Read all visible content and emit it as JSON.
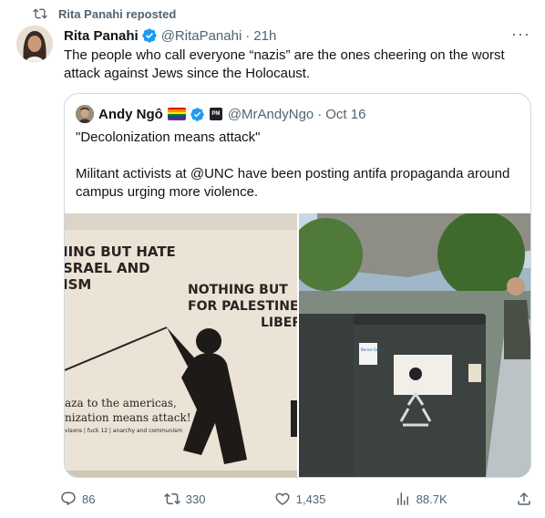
{
  "repost": {
    "label": "Rita Panahi reposted",
    "icon": "repost-icon"
  },
  "tweet": {
    "author_name": "Rita Panahi",
    "author_handle": "@RitaPanahi",
    "separator": "·",
    "time": "21h",
    "more_icon": "more-icon",
    "text": "The people who call everyone “nazis” are the ones cheering on the worst attack against Jews since the Holocaust."
  },
  "quote": {
    "author_name": "Andy Ngô",
    "author_handle": "@MrAndyNgo",
    "separator": "·",
    "date": "Oct 16",
    "badge_label": "PM",
    "text": "\"Decolonization means attack\"\n\nMilitant activists at @UNC have been posting antifa propaganda around campus urging more violence.",
    "poster_lines": [
      "IING BUT HATE",
      "SRAEL AND",
      "ISM",
      "NOTHING BUT",
      "FOR PALESTINE",
      "LIBERA",
      "aza to the americas,",
      "nization means attack!",
      "visons | fuck 12 | anarchy and communism"
    ],
    "sticker_label": "Bernie Seats"
  },
  "actions": {
    "replies": "86",
    "reposts": "330",
    "likes": "1,435",
    "views": "88.7K"
  },
  "colors": {
    "text": "#0f1419",
    "muted": "#536471",
    "verified": "#1d9bf0",
    "border": "#cfd9de"
  }
}
